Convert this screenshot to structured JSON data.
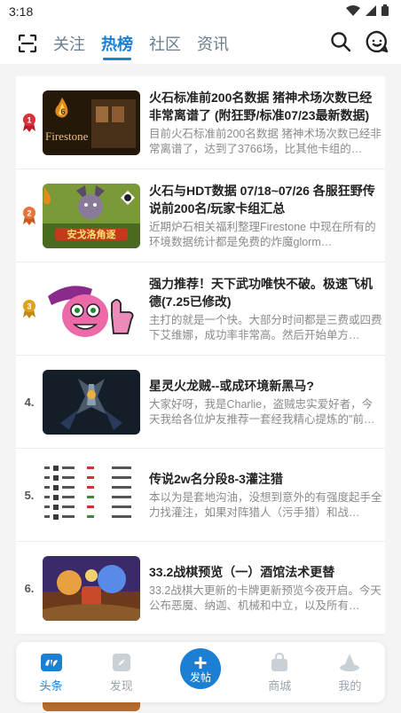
{
  "status": {
    "time": "3:18"
  },
  "header": {
    "tabs": [
      {
        "label": "关注",
        "active": false
      },
      {
        "label": "热榜",
        "active": true
      },
      {
        "label": "社区",
        "active": false
      },
      {
        "label": "资讯",
        "active": false
      }
    ],
    "icons": [
      "scan-icon",
      "search-icon",
      "message-icon"
    ]
  },
  "colors": {
    "accent": "#1b7fd3",
    "rank_gold": "#e0a21a",
    "rank_red": "#d8323a",
    "rank_orange": "#e8743a"
  },
  "items": [
    {
      "rank": "",
      "badge": "rank-1-badge",
      "title": "火石标准前200名数据 猪神术场次数已经非常离谱了 (附狂野/标准07/23最新数据)",
      "excerpt": "目前火石标准前200名数据 猪神术场次数已经非常离谱了，达到了3766场，比其他卡组的…",
      "thumb_text": "Firestone"
    },
    {
      "rank": "",
      "badge": "rank-2-badge",
      "title": "火石与HDT数据 07/18~07/26 各服狂野传说前200名/玩家卡组汇总",
      "excerpt": "近期炉石相关福利整理Firestone 中现在所有的环境数据统计都是免费的炸魔glorm…",
      "thumb_text": "安戈洛角逐"
    },
    {
      "rank": "",
      "badge": "rank-3-badge",
      "title": "强力推荐！天下武功唯快不破。极速飞机德(7.25已修改)",
      "excerpt": "主打的就是一个快。大部分时间都是三费或四费下艾维娜，成功率非常高。然后开始单方…",
      "thumb_text": ""
    },
    {
      "rank": "4.",
      "badge": "",
      "title": "星灵火龙贼--或成环境新黑马?",
      "excerpt": "大家好呀，我是Charlie，盗贼忠实爱好者，今天我给各位炉友推荐一套经我精心提炼的\"前…",
      "thumb_text": ""
    },
    {
      "rank": "5.",
      "badge": "",
      "title": "传说2w名分段8-3灌注猎",
      "excerpt": "本以为是套地沟油，没想到意外的有强度起手全力找灌注，如果对阵猎人（污手猎）和战…",
      "thumb_text": ""
    },
    {
      "rank": "6.",
      "badge": "",
      "title": "33.2战棋预览（一）酒馆法术更替",
      "excerpt": "33.2战棋大更新的卡牌更新预览今夜开启。今天公布恶魔、纳迦、机械和中立，以及所有…",
      "thumb_text": ""
    }
  ],
  "tabbar": [
    {
      "label": "头条",
      "icon": "headline-icon",
      "active": true
    },
    {
      "label": "发现",
      "icon": "discover-icon",
      "active": false
    },
    {
      "label": "发帖",
      "icon": "plus-icon",
      "active": false
    },
    {
      "label": "商城",
      "icon": "shop-icon",
      "active": false
    },
    {
      "label": "我的",
      "icon": "profile-icon",
      "active": false
    }
  ]
}
